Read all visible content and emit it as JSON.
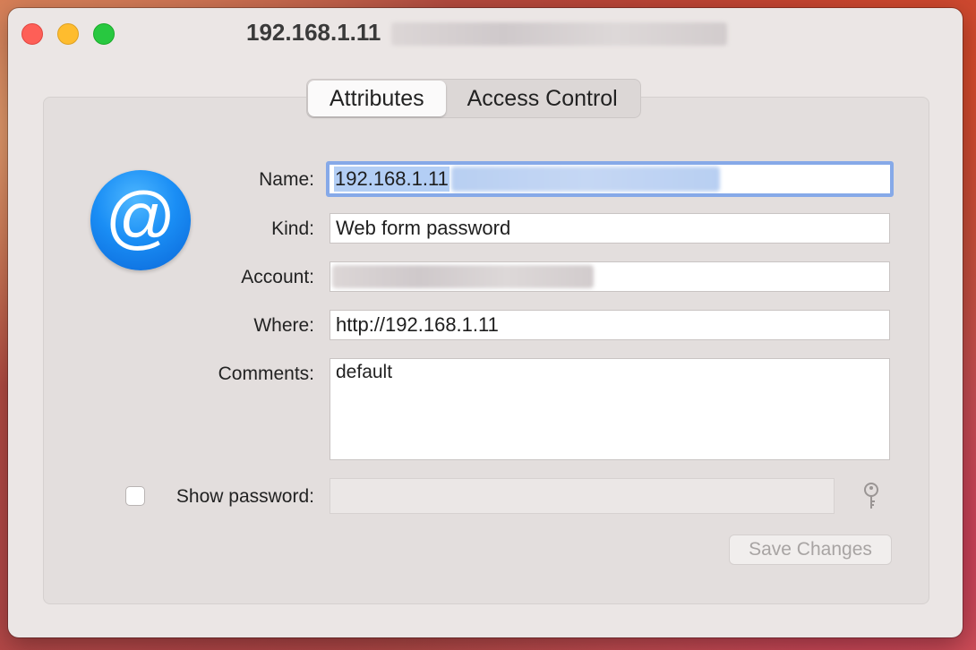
{
  "window": {
    "title": "192.168.1.11"
  },
  "tabs": [
    {
      "label": "Attributes",
      "active": true
    },
    {
      "label": "Access Control",
      "active": false
    }
  ],
  "icon": {
    "name": "at-sign-icon",
    "glyph": "@",
    "color": "#1a8ef5"
  },
  "form": {
    "name_label": "Name:",
    "name_value": "192.168.1.11",
    "kind_label": "Kind:",
    "kind_value": "Web form password",
    "account_label": "Account:",
    "account_value": "",
    "where_label": "Where:",
    "where_value": "http://192.168.1.11",
    "comments_label": "Comments:",
    "comments_value": "default",
    "show_password_label": "Show password:",
    "show_password_checked": false,
    "password_value": ""
  },
  "buttons": {
    "save_label": "Save Changes",
    "save_enabled": false
  },
  "colors": {
    "focus_ring": "#86a9e8",
    "selection": "#b3cef5",
    "close": "#fe5f57",
    "minimize": "#febc2e",
    "maximize": "#28c840"
  }
}
